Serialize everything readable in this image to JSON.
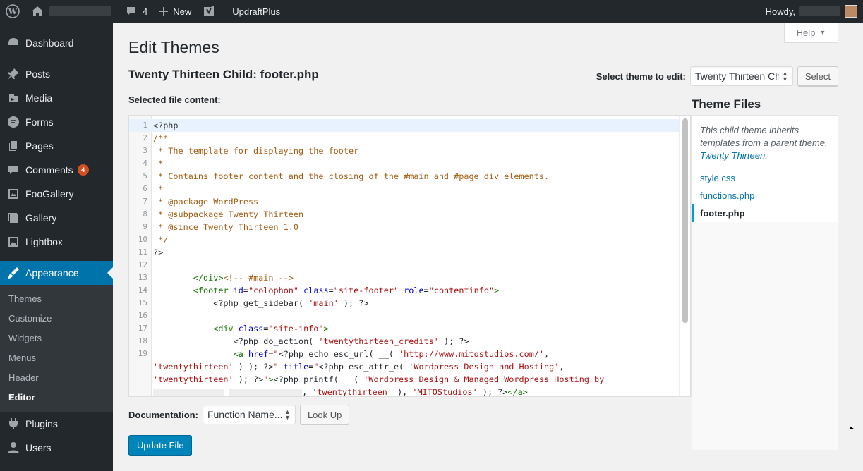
{
  "adminbar": {
    "comments_count": "4",
    "new_label": "New",
    "plugin_label": "UpdraftPlus",
    "howdy_label": "Howdy,"
  },
  "sidebar": {
    "items": [
      {
        "label": "Dashboard",
        "icon": "dashboard-icon"
      },
      {
        "label": "Posts",
        "icon": "pin-icon"
      },
      {
        "label": "Media",
        "icon": "media-icon"
      },
      {
        "label": "Forms",
        "icon": "forms-icon"
      },
      {
        "label": "Pages",
        "icon": "pages-icon"
      },
      {
        "label": "Comments",
        "icon": "comment-icon",
        "badge": "4"
      },
      {
        "label": "FooGallery",
        "icon": "gallery-icon"
      },
      {
        "label": "Gallery",
        "icon": "gallery-icon"
      },
      {
        "label": "Lightbox",
        "icon": "image-icon"
      },
      {
        "label": "Appearance",
        "icon": "brush-icon"
      },
      {
        "label": "Plugins",
        "icon": "plugin-icon"
      },
      {
        "label": "Users",
        "icon": "user-icon"
      }
    ],
    "submenu": [
      "Themes",
      "Customize",
      "Widgets",
      "Menus",
      "Header",
      "Editor"
    ]
  },
  "help_label": "Help",
  "page_title": "Edit Themes",
  "file_title": "Twenty Thirteen Child: footer.php",
  "select_theme": {
    "label": "Select theme to edit:",
    "value": "Twenty Thirteen Ch",
    "button": "Select"
  },
  "selected_file_label": "Selected file content:",
  "theme_files": {
    "title": "Theme Files",
    "description": "This child theme inherits templates from a parent theme,",
    "parent_link": "Twenty Thirteen",
    "files": [
      "style.css",
      "functions.php",
      "footer.php"
    ]
  },
  "documentation": {
    "label": "Documentation:",
    "value": "Function Name...",
    "button": "Look Up"
  },
  "update_button": "Update File"
}
